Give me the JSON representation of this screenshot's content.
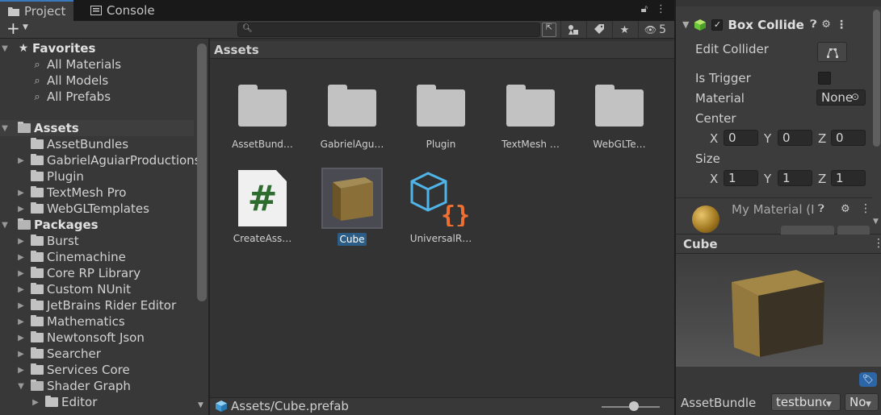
{
  "tabs": [
    {
      "label": "Project",
      "icon": "folder-icon",
      "active": true
    },
    {
      "label": "Console",
      "icon": "console-icon",
      "active": false
    }
  ],
  "toolbar": {
    "create_label": "+",
    "search_value": "",
    "hidden_packages_count": "5"
  },
  "tree": {
    "favorites_label": "Favorites",
    "favorites": [
      "All Materials",
      "All Models",
      "All Prefabs"
    ],
    "assets_label": "Assets",
    "assets": [
      "AssetBundles",
      "GabrielAguiarProductions",
      "Plugin",
      "TextMesh Pro",
      "WebGLTemplates"
    ],
    "packages_label": "Packages",
    "packages": [
      "Burst",
      "Cinemachine",
      "Core RP Library",
      "Custom NUnit",
      "JetBrains Rider Editor",
      "Mathematics",
      "Newtonsoft Json",
      "Searcher",
      "Services Core",
      "Shader Graph"
    ],
    "shader_graph_children": [
      "Editor"
    ]
  },
  "grid": {
    "header": "Assets",
    "items": [
      {
        "name": "AssetBund…",
        "type": "folder"
      },
      {
        "name": "GabrielAgu…",
        "type": "folder"
      },
      {
        "name": "Plugin",
        "type": "folder"
      },
      {
        "name": "TextMesh …",
        "type": "folder"
      },
      {
        "name": "WebGLTe…",
        "type": "folder"
      },
      {
        "name": "CreateAss…",
        "type": "script"
      },
      {
        "name": "Cube",
        "type": "prefab",
        "selected": true
      },
      {
        "name": "UniversalR…",
        "type": "package-json"
      }
    ]
  },
  "footer": {
    "path": "Assets/Cube.prefab"
  },
  "inspector": {
    "component_title": "Box Collider",
    "edit_collider_label": "Edit Collider",
    "is_trigger_label": "Is Trigger",
    "material_label": "Material",
    "material_value": "None",
    "center_label": "Center",
    "center": {
      "x": "0",
      "y": "0",
      "z": "0"
    },
    "size_label": "Size",
    "size": {
      "x": "1",
      "y": "1",
      "z": "1"
    },
    "axis_labels": {
      "x": "X",
      "y": "Y",
      "z": "Z"
    },
    "material_component_title": "My Material (I"
  },
  "preview": {
    "title": "Cube"
  },
  "asset_bundle": {
    "label": "AssetBundle",
    "bundle_value": "testbunc",
    "variant_value": "No"
  },
  "colors": {
    "accent": "#3a79bb",
    "selection": "#2c5d87",
    "cube_top": "#9b8048",
    "cube_front": "#8a6f38"
  }
}
